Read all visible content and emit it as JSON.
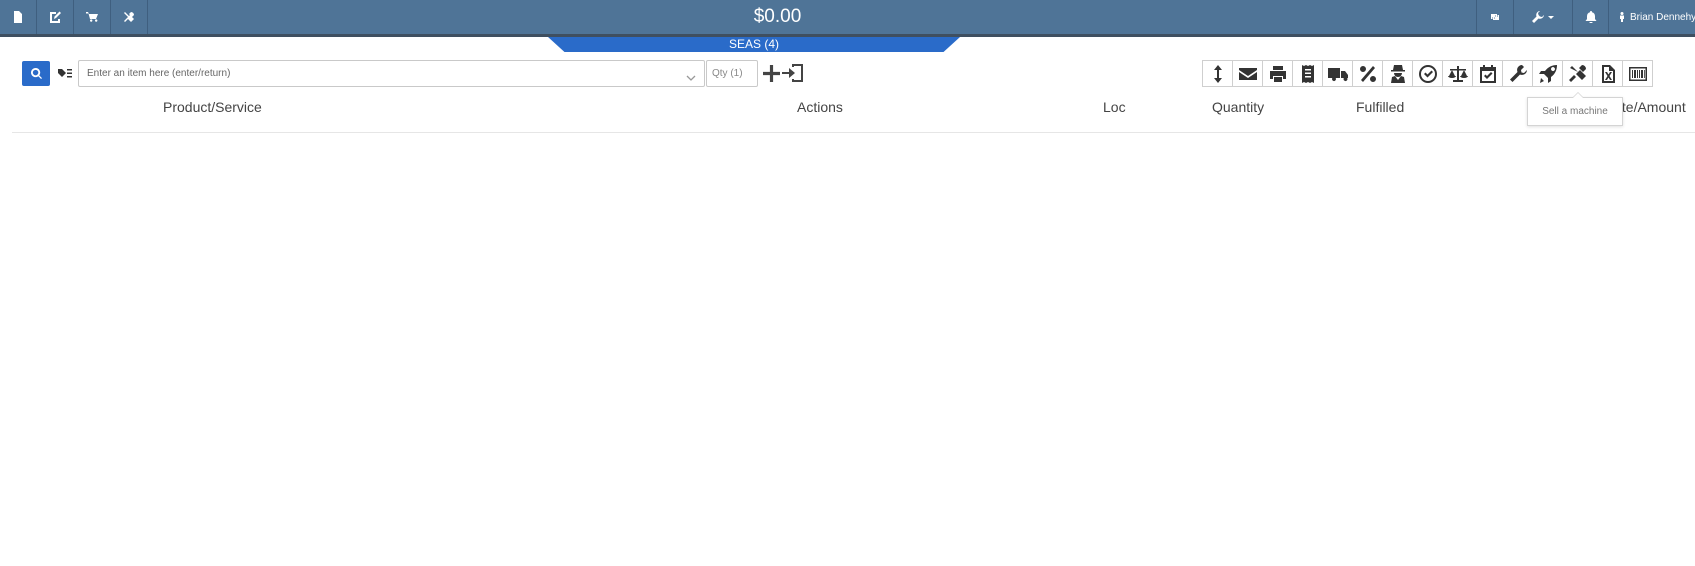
{
  "header": {
    "left_buttons": [
      {
        "icon": "document-icon",
        "name": "new-document-button"
      },
      {
        "icon": "edit-document-icon",
        "name": "edit-document-button"
      },
      {
        "icon": "cart-icon",
        "name": "cart-button"
      },
      {
        "icon": "tools-icon",
        "name": "service-tools-button"
      }
    ],
    "total": "$0.00",
    "right_buttons": [
      {
        "icon": "retweet-icon",
        "name": "refresh-button"
      },
      {
        "icon": "wrench-icon",
        "name": "settings-menu-button",
        "has_caret": true
      },
      {
        "icon": "bell-icon",
        "name": "notifications-button"
      }
    ],
    "user_name": "Brian Dennehy"
  },
  "tab": {
    "label": "SEAS (4)"
  },
  "item_entry": {
    "placeholder": "Enter an item here (enter/return)",
    "qty_placeholder": "Qty (1)"
  },
  "toolbar": {
    "icons": [
      "resize-vertical-icon",
      "envelope-icon",
      "print-icon",
      "receipt-icon",
      "truck-icon",
      "percent-icon",
      "user-secret-icon",
      "check-circle-icon",
      "balance-scale-icon",
      "calendar-check-icon",
      "wrench-icon",
      "rocket-icon",
      "tools-icon",
      "excel-file-icon",
      "barcode-icon"
    ],
    "tooltip": "Sell a machine"
  },
  "table": {
    "columns": [
      "Product/Service",
      "Actions",
      "Loc",
      "Quantity",
      "Fulfilled",
      "Rate/Amount"
    ]
  },
  "colors": {
    "header_bg": "#4f7497",
    "accent_blue": "#2a6bc9"
  }
}
